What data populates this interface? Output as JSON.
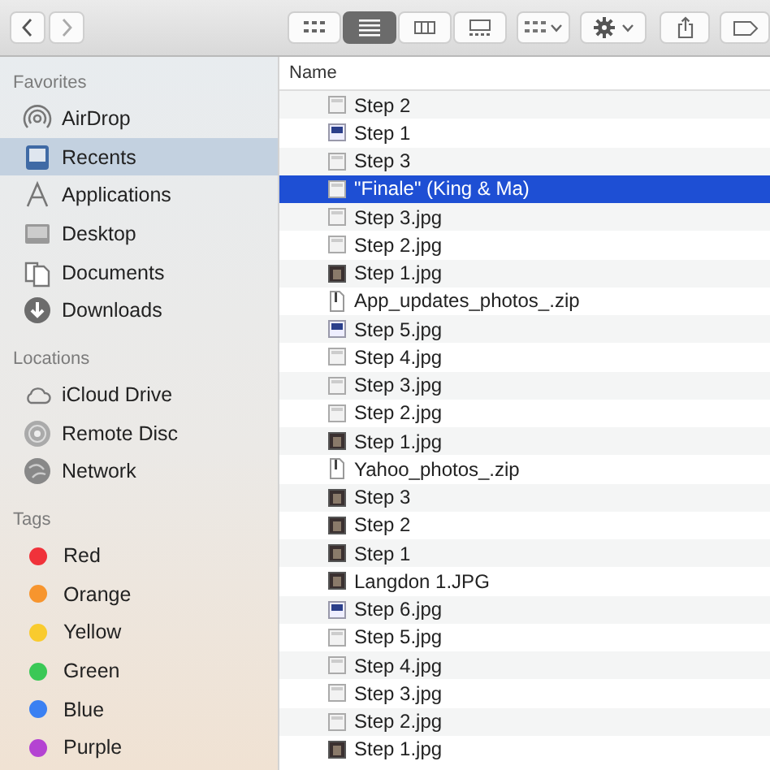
{
  "toolbar": {
    "views": [
      {
        "kind": "icons",
        "selected": false
      },
      {
        "kind": "list",
        "selected": true
      },
      {
        "kind": "columns",
        "selected": false
      },
      {
        "kind": "gallery",
        "selected": false
      }
    ]
  },
  "sidebar": {
    "sections": [
      {
        "title": "Favorites",
        "items": [
          {
            "label": "AirDrop",
            "kind": "airdrop",
            "selected": false
          },
          {
            "label": "Recents",
            "kind": "recents",
            "selected": true
          },
          {
            "label": "Applications",
            "kind": "apps",
            "selected": false
          },
          {
            "label": "Desktop",
            "kind": "desktop",
            "selected": false
          },
          {
            "label": "Documents",
            "kind": "documents",
            "selected": false
          },
          {
            "label": "Downloads",
            "kind": "downloads",
            "selected": false
          }
        ]
      },
      {
        "title": "Locations",
        "items": [
          {
            "label": "iCloud Drive",
            "kind": "cloud",
            "selected": false
          },
          {
            "label": "Remote Disc",
            "kind": "disc",
            "selected": false
          },
          {
            "label": "Network",
            "kind": "network",
            "selected": false
          }
        ]
      },
      {
        "title": "Tags",
        "items": [
          {
            "label": "Red",
            "kind": "tag",
            "color": "#f0323a",
            "selected": false
          },
          {
            "label": "Orange",
            "kind": "tag",
            "color": "#f7952e",
            "selected": false
          },
          {
            "label": "Yellow",
            "kind": "tag",
            "color": "#f9cb2e",
            "selected": false
          },
          {
            "label": "Green",
            "kind": "tag",
            "color": "#3ac856",
            "selected": false
          },
          {
            "label": "Blue",
            "kind": "tag",
            "color": "#3a80f2",
            "selected": false
          },
          {
            "label": "Purple",
            "kind": "tag",
            "color": "#b443d2",
            "selected": false
          }
        ]
      }
    ]
  },
  "files": {
    "columns": [
      "Name"
    ],
    "rows": [
      {
        "name": "Step 2",
        "kind": "light",
        "selected": false
      },
      {
        "name": "Step 1",
        "kind": "blue",
        "selected": false
      },
      {
        "name": "Step 3",
        "kind": "light",
        "selected": false
      },
      {
        "name": "\"Finale\" (King & Ma)",
        "kind": "light",
        "selected": true
      },
      {
        "name": "Step 3.jpg",
        "kind": "light",
        "selected": false
      },
      {
        "name": "Step 2.jpg",
        "kind": "light",
        "selected": false
      },
      {
        "name": "Step 1.jpg",
        "kind": "dark",
        "selected": false
      },
      {
        "name": "App_updates_photos_.zip",
        "kind": "zip",
        "selected": false
      },
      {
        "name": "Step 5.jpg",
        "kind": "blue",
        "selected": false
      },
      {
        "name": "Step 4.jpg",
        "kind": "light",
        "selected": false
      },
      {
        "name": "Step 3.jpg",
        "kind": "light",
        "selected": false
      },
      {
        "name": "Step 2.jpg",
        "kind": "light",
        "selected": false
      },
      {
        "name": "Step 1.jpg",
        "kind": "dark",
        "selected": false
      },
      {
        "name": "Yahoo_photos_.zip",
        "kind": "zip",
        "selected": false
      },
      {
        "name": "Step 3",
        "kind": "dark",
        "selected": false
      },
      {
        "name": "Step 2",
        "kind": "dark",
        "selected": false
      },
      {
        "name": "Step 1",
        "kind": "dark",
        "selected": false
      },
      {
        "name": "Langdon 1.JPG",
        "kind": "dark",
        "selected": false
      },
      {
        "name": "Step 6.jpg",
        "kind": "blue",
        "selected": false
      },
      {
        "name": "Step 5.jpg",
        "kind": "light",
        "selected": false
      },
      {
        "name": "Step 4.jpg",
        "kind": "light",
        "selected": false
      },
      {
        "name": "Step 3.jpg",
        "kind": "light",
        "selected": false
      },
      {
        "name": "Step 2.jpg",
        "kind": "light",
        "selected": false
      },
      {
        "name": "Step 1.jpg",
        "kind": "dark",
        "selected": false
      }
    ]
  }
}
